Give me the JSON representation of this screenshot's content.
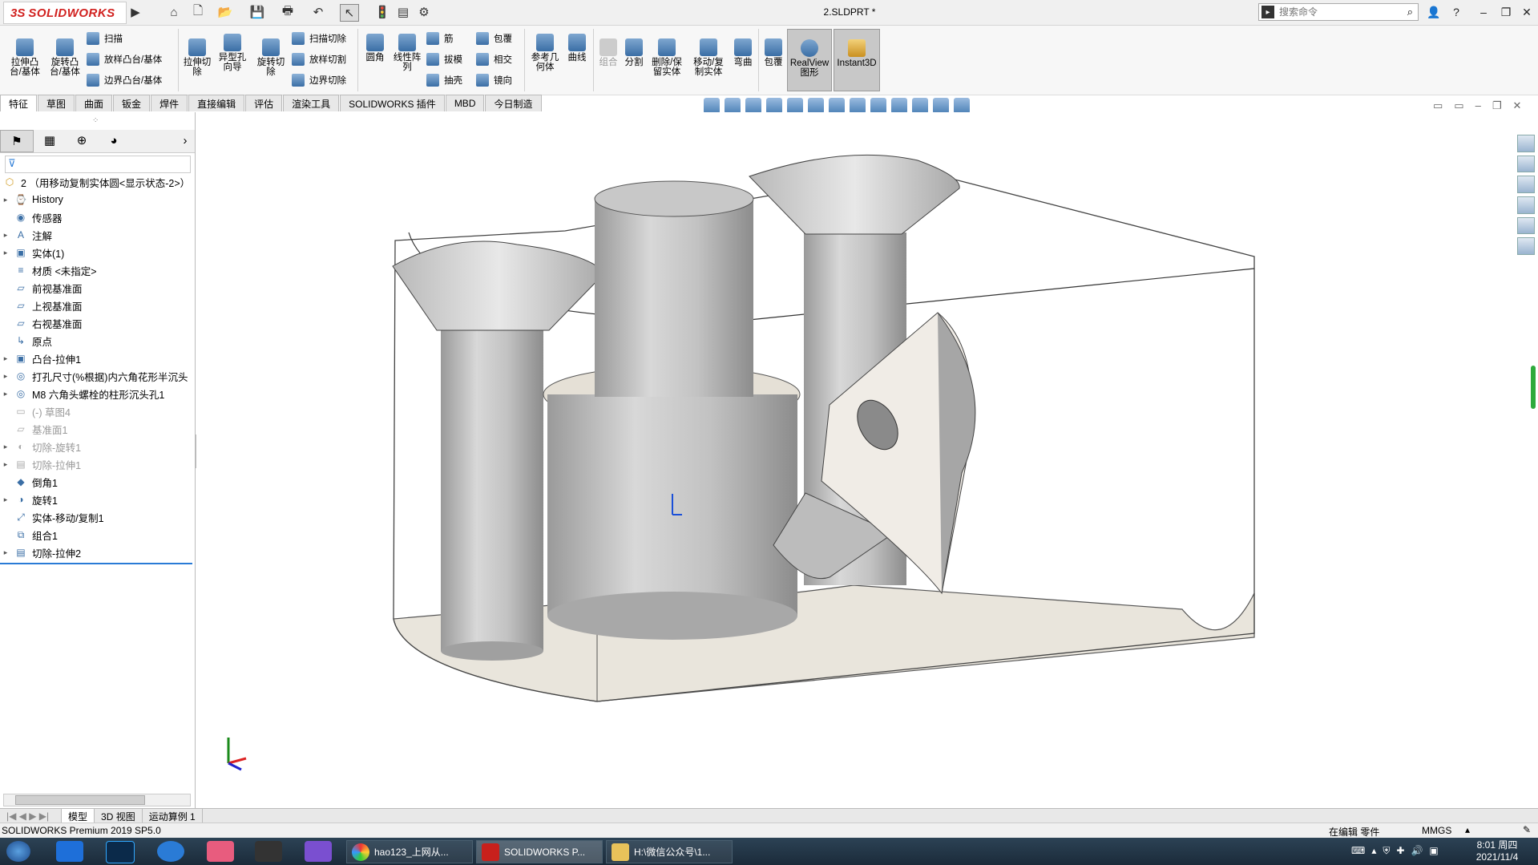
{
  "app": {
    "brand_prefix": "3S",
    "brand_name": "SOLIDWORKS",
    "document_title": "2.SLDPRT *",
    "search_placeholder": "搜索命令"
  },
  "command_manager": {
    "features": [
      {
        "label": "拉伸凸\n台/基体"
      },
      {
        "label": "旋转凸\n台/基体"
      }
    ],
    "small_features": [
      "扫描",
      "放样凸台/基体",
      "边界凸台/基体"
    ],
    "cuts": [
      {
        "label": "拉伸切\n除"
      },
      {
        "label": "异型孔\n向导"
      },
      {
        "label": "旋转切\n除"
      }
    ],
    "small_cuts": [
      "扫描切除",
      "放样切割",
      "边界切除"
    ],
    "features2": [
      {
        "label": "圆角"
      },
      {
        "label": "线性阵\n列"
      }
    ],
    "small_features2": [
      "筋",
      "拔模",
      "抽壳"
    ],
    "small_features3": [
      "包覆",
      "相交",
      "镜向"
    ],
    "ref": [
      {
        "label": "参考几\n何体"
      },
      {
        "label": "曲线"
      }
    ],
    "bodies": [
      {
        "label": "组合",
        "disabled": true
      },
      {
        "label": "分割"
      },
      {
        "label": "删除/保\n留实体"
      },
      {
        "label": "移动/复\n制实体"
      },
      {
        "label": "弯曲"
      },
      {
        "label": "包覆"
      }
    ],
    "realview": "RealView\n图形",
    "instant3d": "Instant3D"
  },
  "tabs": [
    "特征",
    "草图",
    "曲面",
    "钣金",
    "焊件",
    "直接编辑",
    "评估",
    "渲染工具",
    "SOLIDWORKS 插件",
    "MBD",
    "今日制造"
  ],
  "active_tab": "特征",
  "tree": {
    "root": "2 （用移动复制实体圆<显示状态-2>）",
    "items": [
      {
        "label": "History",
        "expandable": true,
        "icon": "history-icon"
      },
      {
        "label": "传感器",
        "expandable": false,
        "icon": "sensor-icon"
      },
      {
        "label": "注解",
        "expandable": true,
        "icon": "annotation-icon"
      },
      {
        "label": "实体(1)",
        "expandable": true,
        "icon": "solid-bodies-icon"
      },
      {
        "label": "材质 <未指定>",
        "expandable": false,
        "icon": "material-icon"
      },
      {
        "label": "前视基准面",
        "expandable": false,
        "icon": "plane-icon"
      },
      {
        "label": "上视基准面",
        "expandable": false,
        "icon": "plane-icon"
      },
      {
        "label": "右视基准面",
        "expandable": false,
        "icon": "plane-icon"
      },
      {
        "label": "原点",
        "expandable": false,
        "icon": "origin-icon"
      },
      {
        "label": "凸台-拉伸1",
        "expandable": true,
        "icon": "extrude-icon"
      },
      {
        "label": "打孔尺寸(%根据)内六角花形半沉头",
        "expandable": true,
        "icon": "hole-icon"
      },
      {
        "label": "M8 六角头螺栓的柱形沉头孔1",
        "expandable": true,
        "icon": "hole-icon"
      },
      {
        "label": "(-) 草图4",
        "expandable": false,
        "icon": "sketch-icon",
        "disabled": true
      },
      {
        "label": "基准面1",
        "expandable": false,
        "icon": "plane-icon",
        "disabled": true
      },
      {
        "label": "切除-旋转1",
        "expandable": true,
        "icon": "revolve-cut-icon",
        "disabled": true
      },
      {
        "label": "切除-拉伸1",
        "expandable": true,
        "icon": "extrude-cut-icon",
        "disabled": true
      },
      {
        "label": "倒角1",
        "expandable": false,
        "icon": "chamfer-icon"
      },
      {
        "label": "旋转1",
        "expandable": true,
        "icon": "revolve-icon"
      },
      {
        "label": "实体-移动/复制1",
        "expandable": false,
        "icon": "move-copy-icon"
      },
      {
        "label": "组合1",
        "expandable": false,
        "icon": "combine-icon"
      },
      {
        "label": "切除-拉伸2",
        "expandable": true,
        "icon": "extrude-cut-icon"
      }
    ]
  },
  "bottom_tabs": [
    "模型",
    "3D 视图",
    "运动算例 1"
  ],
  "status": {
    "product": "SOLIDWORKS Premium 2019 SP5.0",
    "mode": "在编辑 零件",
    "units": "MMGS"
  },
  "taskbar": {
    "apps": [
      {
        "label": "hao123_上网从..."
      },
      {
        "label": "SOLIDWORKS P..."
      },
      {
        "label": "H:\\微信公众号\\1..."
      }
    ],
    "time": "8:01 周四",
    "date": "2021/11/4"
  }
}
